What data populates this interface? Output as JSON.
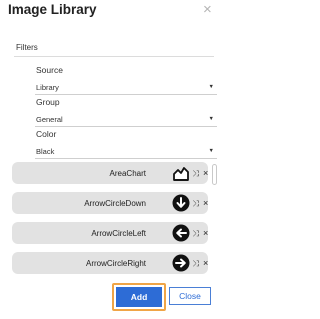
{
  "dialog": {
    "title": "Image Library",
    "close_glyph": "×"
  },
  "filters": {
    "heading": "Filters",
    "source": {
      "label": "Source",
      "value": "Library"
    },
    "group": {
      "label": "Group",
      "value": "General"
    },
    "color": {
      "label": "Color",
      "value": "Black"
    },
    "caret_glyph": "▼"
  },
  "images": [
    {
      "name": "AreaChart",
      "icon": "area-chart-icon"
    },
    {
      "name": "ArrowCircleDown",
      "icon": "arrow-circle-down-icon"
    },
    {
      "name": "ArrowCircleLeft",
      "icon": "arrow-circle-left-icon"
    },
    {
      "name": "ArrowCircleRight",
      "icon": "arrow-circle-right-icon"
    }
  ],
  "row_actions": {
    "shuffle_glyph": "⤨",
    "remove_glyph": "×"
  },
  "footer": {
    "add_label": "Add",
    "close_label": "Close"
  },
  "colors": {
    "accent": "#2d6cd6",
    "focus_ring": "#f0a547",
    "row_bg": "#e2e2e2"
  }
}
